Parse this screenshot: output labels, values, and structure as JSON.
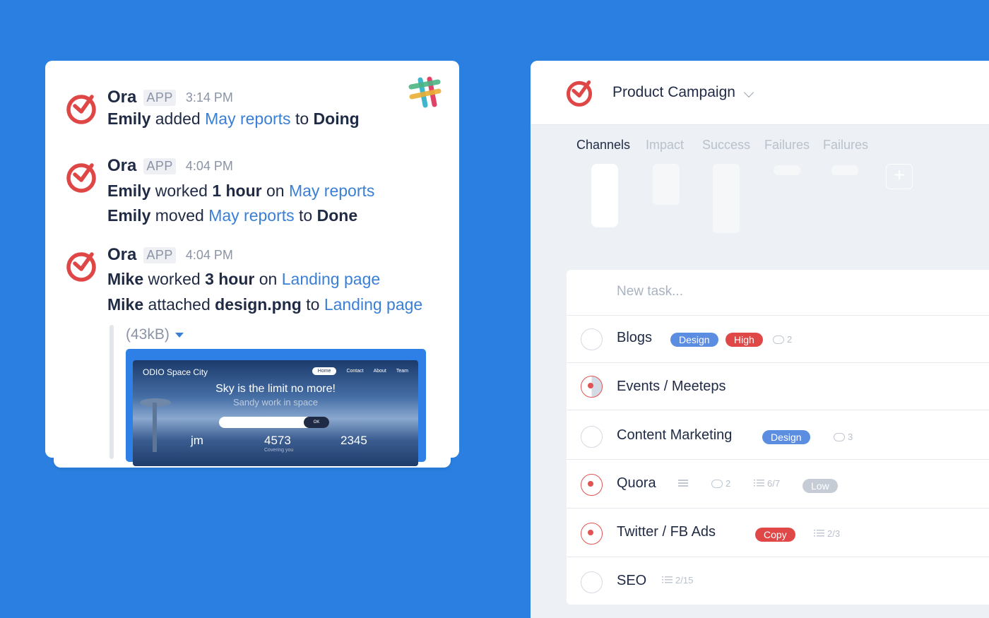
{
  "colors": {
    "background": "#2a7fe0",
    "accent": "#3a7fd6",
    "danger": "#e04848",
    "text": "#1f2a44"
  },
  "slack": {
    "messages": [
      {
        "sender": "Ora",
        "badge": "APP",
        "time": "3:14 PM",
        "lines": [
          {
            "parts": [
              {
                "t": "Emily",
                "s": "bold"
              },
              {
                "t": " added ",
                "s": "plain"
              },
              {
                "t": "May reports",
                "s": "link"
              },
              {
                "t": " to ",
                "s": "plain"
              },
              {
                "t": "Doing",
                "s": "bold"
              }
            ]
          }
        ]
      },
      {
        "sender": "Ora",
        "badge": "APP",
        "time": "4:04 PM",
        "lines": [
          {
            "parts": [
              {
                "t": "Emily",
                "s": "bold"
              },
              {
                "t": " worked ",
                "s": "plain"
              },
              {
                "t": "1 hour",
                "s": "bold"
              },
              {
                "t": " on ",
                "s": "plain"
              },
              {
                "t": "May reports",
                "s": "link"
              }
            ]
          },
          {
            "parts": [
              {
                "t": "Emily",
                "s": "bold"
              },
              {
                "t": " moved ",
                "s": "plain"
              },
              {
                "t": "May reports",
                "s": "link"
              },
              {
                "t": " to ",
                "s": "plain"
              },
              {
                "t": "Done",
                "s": "bold"
              }
            ]
          }
        ]
      },
      {
        "sender": "Ora",
        "badge": "APP",
        "time": "4:04 PM",
        "lines": [
          {
            "parts": [
              {
                "t": "Mike",
                "s": "bold"
              },
              {
                "t": " worked ",
                "s": "plain"
              },
              {
                "t": "3 hour",
                "s": "bold"
              },
              {
                "t": " on ",
                "s": "plain"
              },
              {
                "t": "Landing page",
                "s": "link"
              }
            ]
          },
          {
            "parts": [
              {
                "t": "Mike",
                "s": "bold"
              },
              {
                "t": " attached ",
                "s": "plain"
              },
              {
                "t": "design.png",
                "s": "bold"
              },
              {
                "t": " to ",
                "s": "plain"
              },
              {
                "t": "Landing page",
                "s": "link"
              }
            ]
          }
        ]
      }
    ],
    "attachment": {
      "size": "(43kB)",
      "preview": {
        "brand": "ODIO Space City",
        "nav": [
          "Home",
          "Contact",
          "About",
          "Team"
        ],
        "headline": "Sky is the limit no more!",
        "subline": "Sandy work in space",
        "search_button": "OK",
        "stats": [
          "jm",
          "4573",
          "2345"
        ],
        "stat_label": "Covering you"
      }
    }
  },
  "ora": {
    "project_title": "Product Campaign",
    "tabs": [
      "Channels",
      "Impact",
      "Success",
      "Failures",
      "Failures"
    ],
    "new_task_placeholder": "New task...",
    "tasks": [
      {
        "name": "Blogs",
        "state": "empty",
        "tags": [
          "Design",
          "High"
        ],
        "comments": "2"
      },
      {
        "name": "Events / Meeteps",
        "state": "in-progress"
      },
      {
        "name": "Content Marketing",
        "state": "empty",
        "tags": [
          "Design"
        ],
        "comments": "3"
      },
      {
        "name": "Quora",
        "state": "active",
        "comments": "2",
        "checklist": "6/7",
        "tags": [
          "Low"
        ]
      },
      {
        "name": "Twitter / FB Ads",
        "state": "active",
        "tags": [
          "Copy"
        ],
        "checklist": "2/3"
      },
      {
        "name": "SEO",
        "state": "empty",
        "checklist": "2/15"
      }
    ]
  }
}
